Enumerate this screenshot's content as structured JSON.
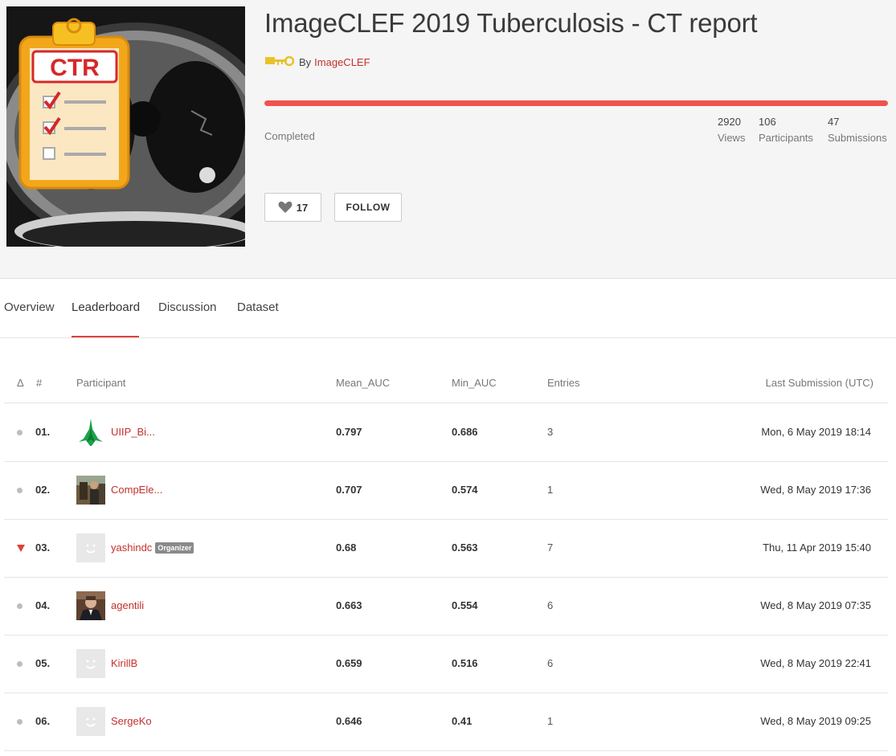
{
  "challenge": {
    "title": "ImageCLEF 2019 Tuberculosis - CT report",
    "by_label": "By",
    "organizer": "ImageCLEF",
    "progress_fraction": 1.0,
    "status": "Completed",
    "cover_text": "CTR",
    "stats": [
      {
        "value": "2920",
        "label": "Views"
      },
      {
        "value": "106",
        "label": "Participants"
      },
      {
        "value": "47",
        "label": "Submissions"
      }
    ],
    "likes": "17",
    "follow_label": "FOLLOW"
  },
  "tabs": [
    {
      "label": "Overview",
      "active": false
    },
    {
      "label": "Leaderboard",
      "active": true
    },
    {
      "label": "Discussion",
      "active": false
    },
    {
      "label": "Dataset",
      "active": false
    }
  ],
  "leaderboard": {
    "headers": {
      "delta": "Δ",
      "rank": "#",
      "participant": "Participant",
      "mean_auc": "Mean_AUC",
      "min_auc": "Min_AUC",
      "entries": "Entries",
      "last_submission": "Last Submission (UTC)"
    },
    "rows": [
      {
        "change": "same",
        "rank": "01.",
        "avatar": "tree-logo",
        "name": "UIIP_Bi...",
        "badge": "",
        "mean_auc": "0.797",
        "min_auc": "0.686",
        "entries": "3",
        "last_submission": "Mon, 6 May 2019 18:14"
      },
      {
        "change": "same",
        "rank": "02.",
        "avatar": "photo-outdoor",
        "name": "CompEle...",
        "badge": "",
        "mean_auc": "0.707",
        "min_auc": "0.574",
        "entries": "1",
        "last_submission": "Wed, 8 May 2019 17:36"
      },
      {
        "change": "down",
        "rank": "03.",
        "avatar": "default-smiley",
        "name": "yashindc",
        "badge": "Organizer",
        "mean_auc": "0.68",
        "min_auc": "0.563",
        "entries": "7",
        "last_submission": "Thu, 11 Apr 2019 15:40"
      },
      {
        "change": "same",
        "rank": "04.",
        "avatar": "photo-portrait",
        "name": "agentili",
        "badge": "",
        "mean_auc": "0.663",
        "min_auc": "0.554",
        "entries": "6",
        "last_submission": "Wed, 8 May 2019 07:35"
      },
      {
        "change": "same",
        "rank": "05.",
        "avatar": "default-smiley",
        "name": "KirillB",
        "badge": "",
        "mean_auc": "0.659",
        "min_auc": "0.516",
        "entries": "6",
        "last_submission": "Wed, 8 May 2019 22:41"
      },
      {
        "change": "same",
        "rank": "06.",
        "avatar": "default-smiley",
        "name": "SergeKo",
        "badge": "",
        "mean_auc": "0.646",
        "min_auc": "0.41",
        "entries": "1",
        "last_submission": "Wed, 8 May 2019 09:25"
      }
    ]
  },
  "colors": {
    "accent": "#e0403b",
    "link": "#c3312d",
    "progress": "#f0524e"
  }
}
